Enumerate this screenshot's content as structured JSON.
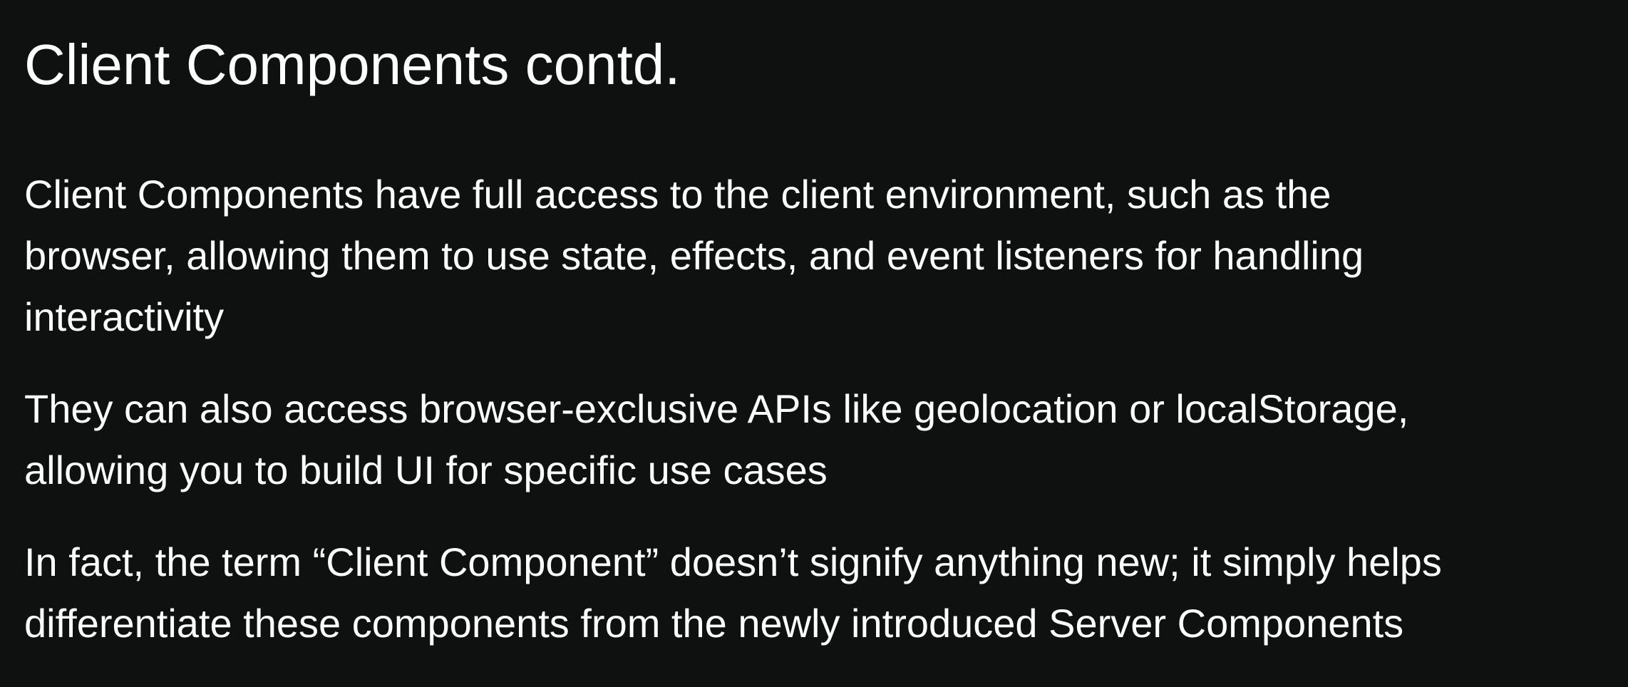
{
  "slide": {
    "title": "Client Components contd.",
    "paragraphs": [
      {
        "lines": [
          "Client Components have full access to the client environment, such as the",
          "browser, allowing them to use state, effects, and event listeners for handling",
          "interactivity"
        ]
      },
      {
        "lines": [
          "They can also access browser-exclusive APIs like geolocation or localStorage,",
          "allowing you to build UI for specific use cases"
        ]
      },
      {
        "lines": [
          "In fact, the term “Client Component” doesn’t signify anything new; it simply helps",
          "differentiate these components from the newly introduced Server Components"
        ]
      }
    ]
  },
  "colors": {
    "background": "#0e1110",
    "text": "#ffffff"
  }
}
